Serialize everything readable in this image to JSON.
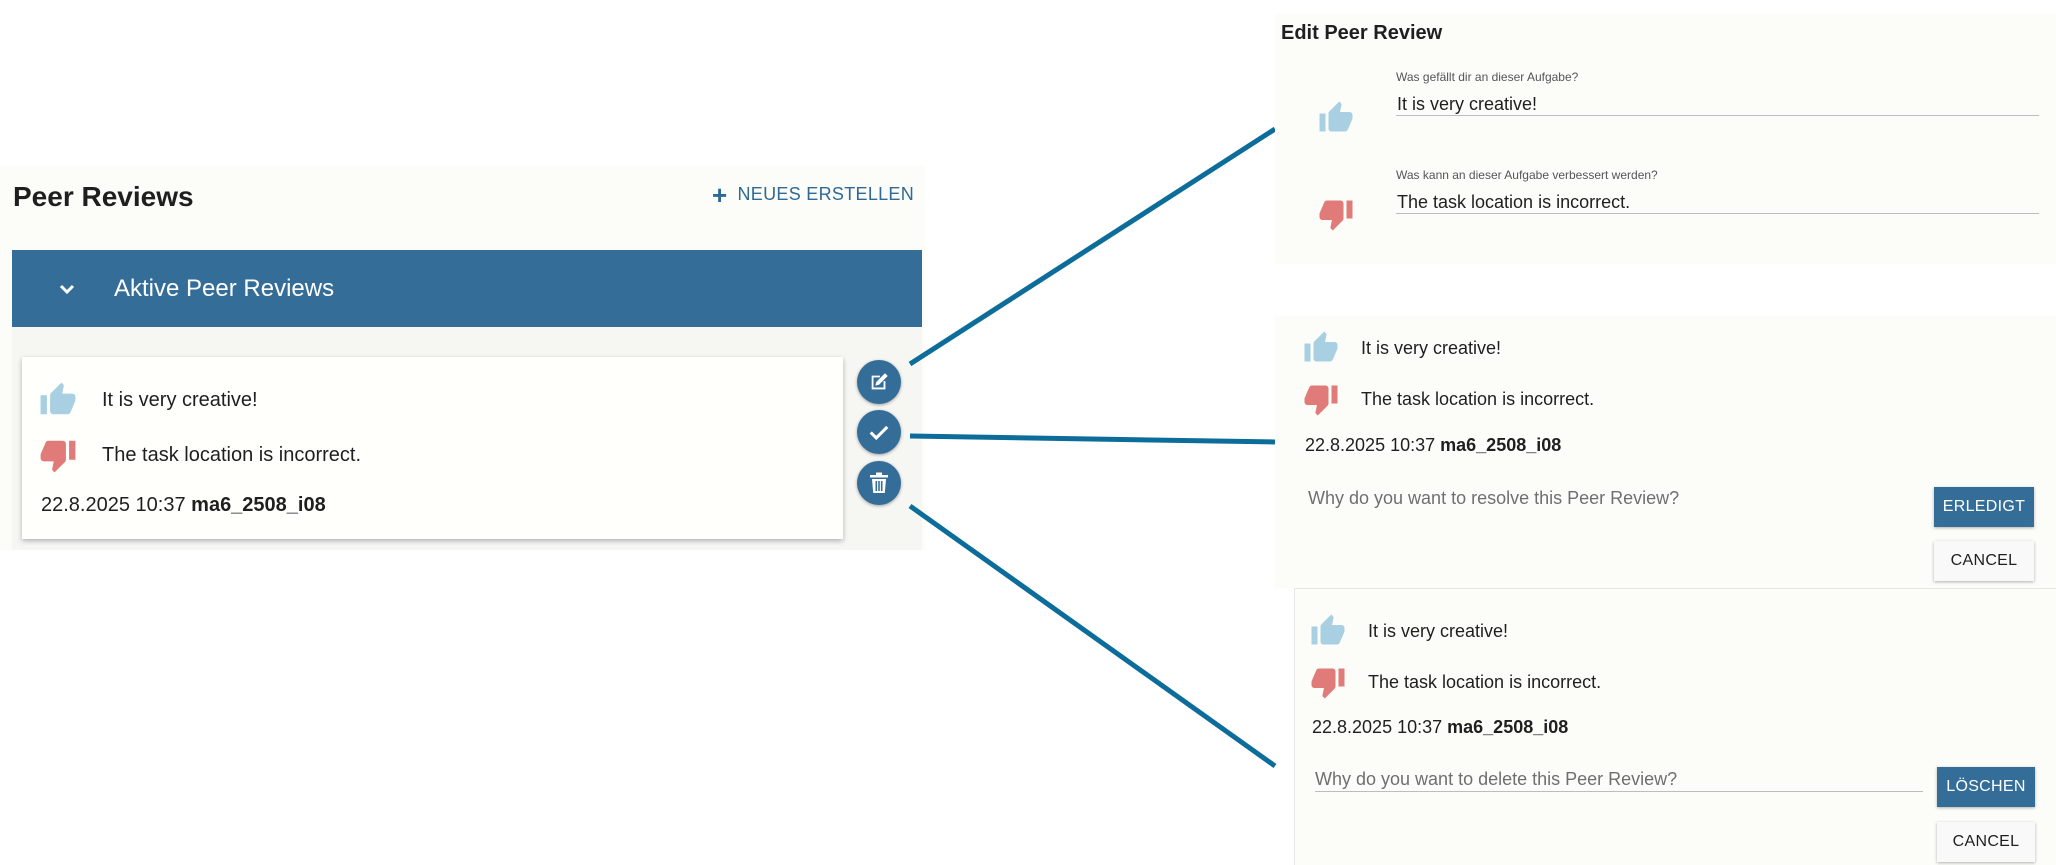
{
  "colors": {
    "primary": "#356d99",
    "thumbs_up": "#a9cfe3",
    "thumbs_down": "#e07b79",
    "connector": "#0d6d9a"
  },
  "left": {
    "title": "Peer Reviews",
    "new_button": "NEUES ERSTELLEN",
    "accordion_label": "Aktive Peer Reviews",
    "card": {
      "positive": "It is very creative!",
      "negative": "The task location is incorrect.",
      "date": "22.8.2025 10:37",
      "user": "ma6_2508_i08"
    }
  },
  "edit": {
    "title": "Edit Peer Review",
    "positive_label": "Was gefällt dir an dieser Aufgabe?",
    "positive_value": "It is very creative!",
    "negative_label": "Was kann an dieser Aufgabe verbessert werden?",
    "negative_value": "The task location is incorrect."
  },
  "resolve": {
    "positive": "It is very creative!",
    "negative": "The task location is incorrect.",
    "date": "22.8.2025 10:37",
    "user": "ma6_2508_i08",
    "placeholder": "Why do you want to resolve this Peer Review?",
    "confirm_label": "ERLEDIGT",
    "cancel_label": "CANCEL"
  },
  "delete": {
    "positive": "It is very creative!",
    "negative": "The task location is incorrect.",
    "date": "22.8.2025 10:37",
    "user": "ma6_2508_i08",
    "placeholder": "Why do you want to delete this Peer Review?",
    "confirm_label": "LÖSCHEN",
    "cancel_label": "CANCEL"
  }
}
